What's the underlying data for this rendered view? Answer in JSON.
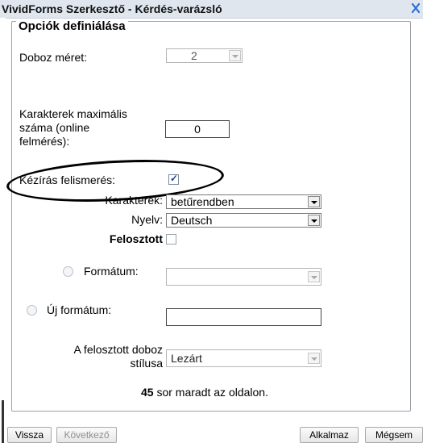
{
  "title": "VividForms Szerkesztő - Kérdés-varázsló",
  "section": {
    "legend": "Opciók definiálása"
  },
  "fields": {
    "box_size": {
      "label": "Doboz méret:",
      "value": "2"
    },
    "max_chars": {
      "label_line1": "Karakterek maximális",
      "label_line2": "száma (online",
      "label_line3": "felmérés):",
      "value": "0"
    },
    "handwriting": {
      "label": "Kézírás felismerés:",
      "checked": true
    },
    "characters": {
      "label": "Karakterek:",
      "value": "betűrendben"
    },
    "language": {
      "label": "Nyelv:",
      "value": "Deutsch"
    },
    "split": {
      "label": "Felosztott",
      "checked": false
    },
    "format": {
      "label": "Formátum:",
      "value": ""
    },
    "new_format": {
      "label": "Új formátum:",
      "value": ""
    },
    "split_box_style": {
      "label_line1": "A felosztott doboz",
      "label_line2": "stílusa",
      "value": "Lezárt"
    }
  },
  "remaining": {
    "count": "45",
    "text": "sor maradt az oldalon."
  },
  "buttons": {
    "back": "Vissza",
    "next": "Következő",
    "apply": "Alkalmaz",
    "cancel": "Mégsem"
  },
  "icons": {
    "close": "close-icon"
  },
  "colors": {
    "titlebar_bg": "#dfe6ee",
    "checkmark": "#1a3f9a"
  }
}
